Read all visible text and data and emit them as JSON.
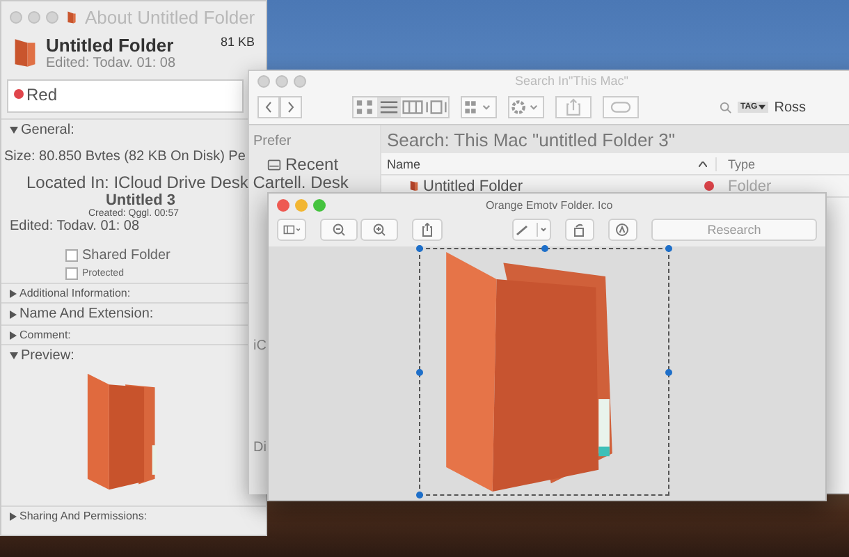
{
  "info_window": {
    "title": "About Untitled Folder",
    "name": "Untitled Folder",
    "size": "81 KB",
    "edited": "Edited: Todav. 01: 08",
    "tag": {
      "label": "Red",
      "color": "#e0454b"
    },
    "general": {
      "label": "General:",
      "expanded": true,
      "size_text": "Size: 80.850 Bvtes (82 KB On Disk) Pe",
      "located": "Located In: ICloud Drive Desk Cartell. Desk",
      "folder": "Untitled 3",
      "created": "Created: Qggl. 00:57",
      "edited": "Edited: Todav. 01: 08",
      "options": [
        {
          "label": "Shared Folder",
          "checked": false,
          "kind": "big"
        },
        {
          "label": "Protected",
          "checked": false,
          "kind": "small"
        }
      ]
    },
    "sections": [
      {
        "label": "Additional Information:",
        "expanded": false,
        "kind": "small"
      },
      {
        "label": "Name And Extension:",
        "expanded": false,
        "kind": "big"
      },
      {
        "label": "Comment:",
        "expanded": false,
        "kind": "small"
      },
      {
        "label": "Preview:",
        "expanded": true,
        "kind": "big"
      },
      {
        "label": "Sharing And Permissions:",
        "expanded": false,
        "kind": "small"
      }
    ]
  },
  "finder_window": {
    "title": "Search In\"This Mac\"",
    "search_tag": "TAG",
    "search_value": "Ross",
    "sidebar": [
      {
        "header": "Prefer",
        "items": [
          {
            "label": "Recent",
            "selected": false
          }
        ]
      },
      {
        "header": "iC"
      },
      {
        "header": "Di"
      }
    ],
    "search_path": "Search: This Mac \"untitled Folder 3\"",
    "columns": [
      "Name",
      "Type"
    ],
    "rows": [
      {
        "name": "Untitled Folder",
        "color": "#e0454b",
        "type": "Folder"
      }
    ]
  },
  "preview_window": {
    "title": "Orange Emotv Folder. Ico",
    "search_placeholder": "Research"
  }
}
